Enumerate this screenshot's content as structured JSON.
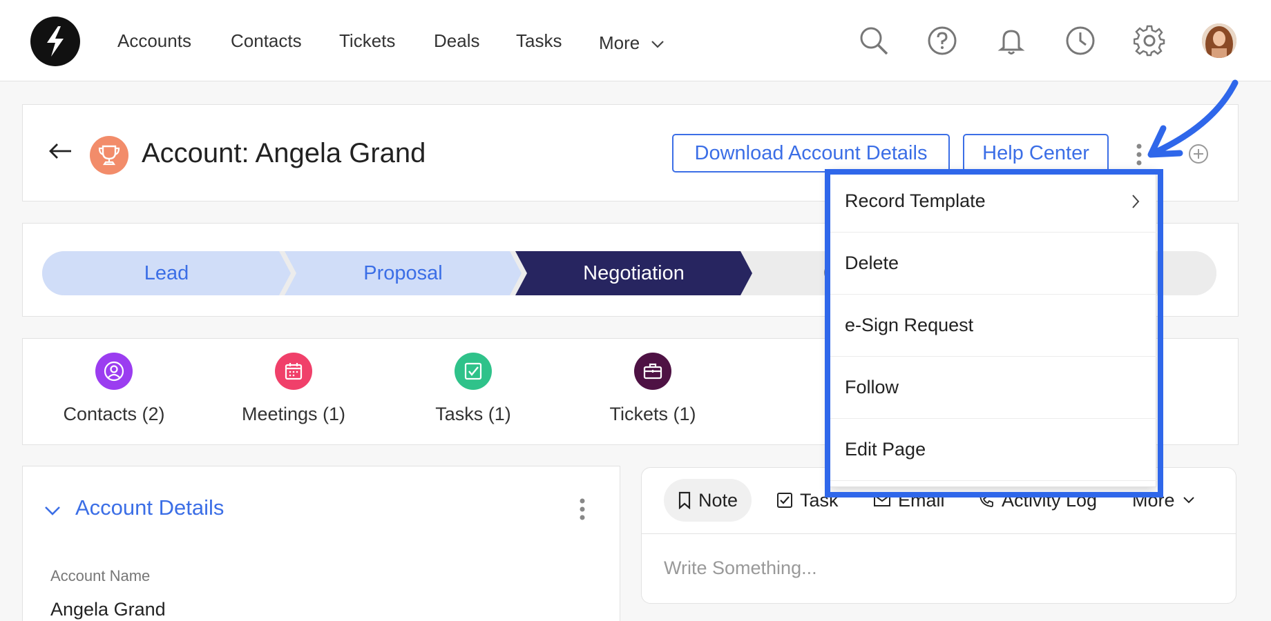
{
  "nav": {
    "links": [
      "Accounts",
      "Contacts",
      "Tickets",
      "Deals",
      "Tasks"
    ],
    "more_label": "More",
    "icons": [
      "search-icon",
      "help-icon",
      "bell-icon",
      "clock-icon",
      "gear-icon"
    ]
  },
  "header": {
    "title": "Account: Angela Grand",
    "download_label": "Download Account Details",
    "help_label": "Help Center"
  },
  "pipeline": {
    "stages": [
      {
        "label": "Lead",
        "state": "completed"
      },
      {
        "label": "Proposal",
        "state": "completed"
      },
      {
        "label": "Negotiation",
        "state": "current"
      },
      {
        "label": "Qu",
        "state": "upcoming"
      }
    ]
  },
  "related": {
    "items": [
      {
        "label": "Contacts (2)",
        "icon": "contact-icon",
        "color": "#9b3df0"
      },
      {
        "label": "Meetings (1)",
        "icon": "calendar-icon",
        "color": "#f0406a"
      },
      {
        "label": "Tasks (1)",
        "icon": "checkbox-icon",
        "color": "#2fc28a"
      },
      {
        "label": "Tickets (1)",
        "icon": "briefcase-icon",
        "color": "#4e1244"
      }
    ]
  },
  "details": {
    "title": "Account Details",
    "field_label": "Account Name",
    "field_value": "Angela Grand"
  },
  "activity": {
    "tabs": [
      "Note",
      "Task",
      "Email",
      "Activity Log",
      "More"
    ],
    "placeholder": "Write Something..."
  },
  "dropdown": {
    "items": [
      "Record Template",
      "Delete",
      "e-Sign Request",
      "Follow",
      "Edit Page"
    ]
  },
  "colors": {
    "accent": "#3b6ee6",
    "stage_completed": "#d0ddf8",
    "stage_current": "#272560",
    "highlight": "#2f67ea"
  }
}
